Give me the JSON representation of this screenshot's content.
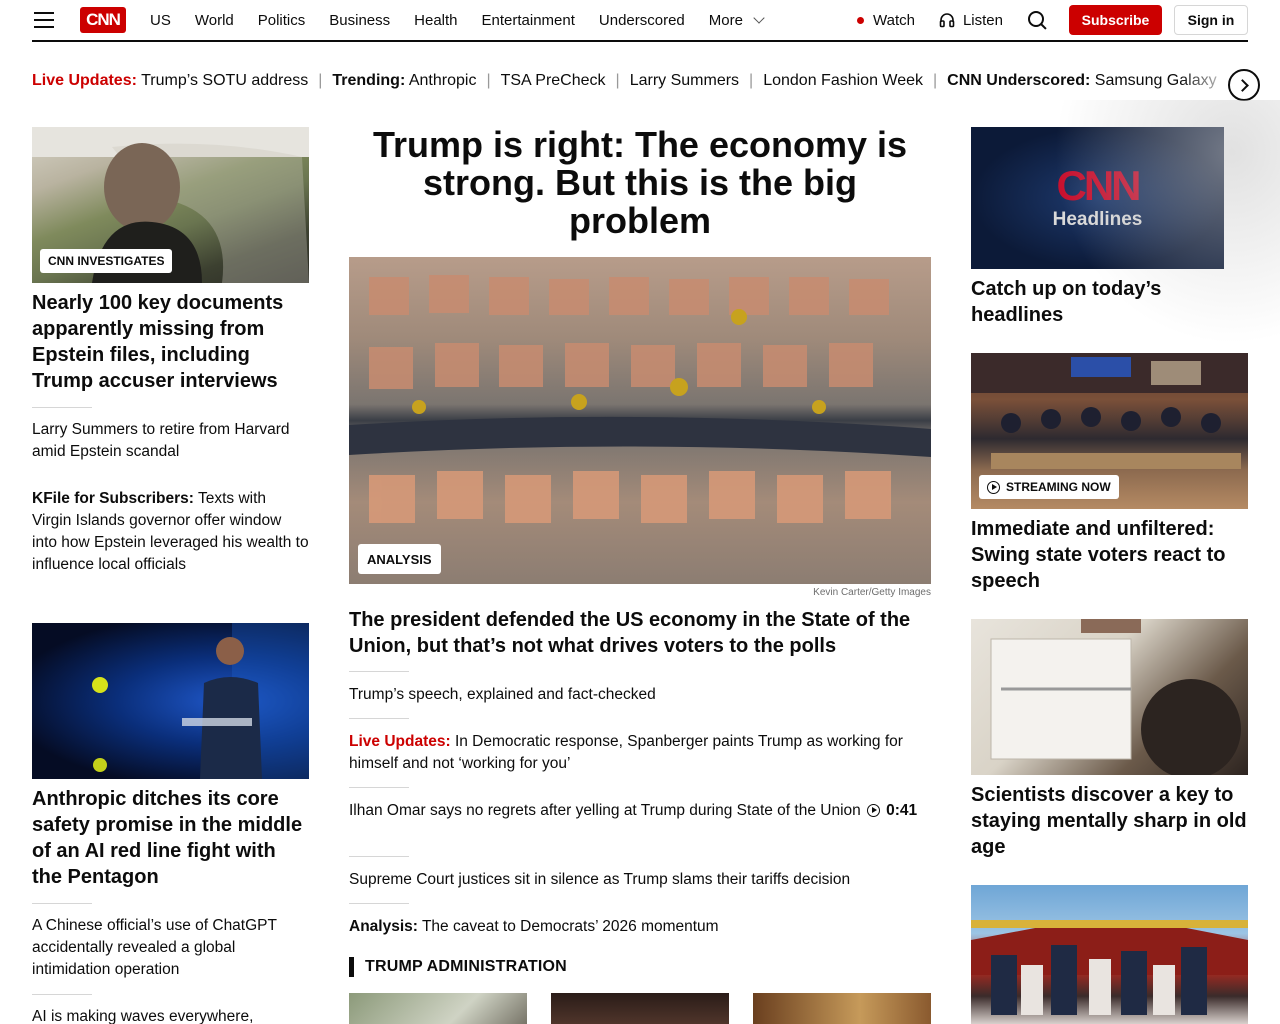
{
  "header": {
    "logo": "CNN",
    "nav": [
      "US",
      "World",
      "Politics",
      "Business",
      "Health",
      "Entertainment",
      "Underscored"
    ],
    "more_label": "More",
    "watch_label": "Watch",
    "listen_label": "Listen",
    "subscribe_label": "Subscribe",
    "signin_label": "Sign in"
  },
  "ticker": {
    "items": [
      {
        "label": "Live Updates:",
        "text": "Trump’s SOTU address"
      },
      {
        "label": "Trending:",
        "text": "Anthropic"
      },
      {
        "label": "",
        "text": "TSA PreCheck"
      },
      {
        "label": "",
        "text": "Larry Summers"
      },
      {
        "label": "",
        "text": "London Fashion Week"
      },
      {
        "label": "CNN Underscored:",
        "text": "Samsung Galaxy"
      }
    ]
  },
  "left": {
    "story1": {
      "badge": "CNN INVESTIGATES",
      "headline": "Nearly 100 key documents apparently missing from Epstein files, including Trump accuser interviews"
    },
    "link1": "Larry Summers to retire from Harvard amid Epstein scandal",
    "link2_label": "KFile for Subscribers:",
    "link2_text": " Texts with Virgin Islands governor offer window into how Epstein leveraged his wealth to influence local officials",
    "story2": {
      "headline": "Anthropic ditches its core safety promise in the middle of an AI red line fight with the Pentagon"
    },
    "link3": "A Chinese official’s use of ChatGPT accidentally revealed a global intimidation operation",
    "link4": "AI is making waves everywhere,"
  },
  "center": {
    "title": "Trump is right: The economy is strong. But this is the big problem",
    "badge": "ANALYSIS",
    "credit": "Kevin Carter/Getty Images",
    "subhead": "The president defended the US economy in the State of the Union, but that’s not what drives voters to the polls",
    "links": [
      {
        "label": "",
        "text": "Trump’s speech, explained and fact-checked"
      },
      {
        "label": "Live Updates:",
        "text": " In Democratic response, Spanberger paints Trump as working for himself and not ‘working for you’"
      },
      {
        "label": "",
        "text": "Ilhan Omar says no regrets after yelling at Trump during State of the Union "
      },
      {
        "label": "",
        "text": "Supreme Court justices sit in silence as Trump slams their tariffs decision"
      },
      {
        "label": "Analysis:",
        "text": " The caveat to Democrats’ 2026 momentum"
      }
    ],
    "video_duration": "0:41",
    "section_title": "TRUMP ADMINISTRATION"
  },
  "right": {
    "cnn_headlines_logo": "CNN",
    "cnn_headlines_word": "Headlines",
    "story1": "Catch up on today’s headlines",
    "stream_badge": "STREAMING NOW",
    "story2": "Immediate and unfiltered: Swing state voters react to speech",
    "story3": "Scientists discover a key to staying mentally sharp in old age"
  },
  "colors": {
    "brand_red": "#cc0000",
    "text": "#0c0c0c",
    "divider": "#d6d6d6"
  }
}
